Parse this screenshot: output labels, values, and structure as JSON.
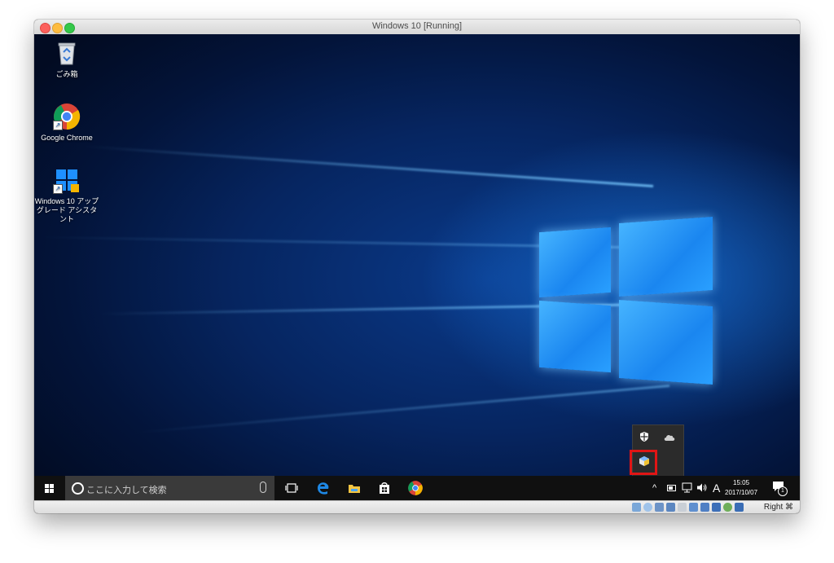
{
  "window": {
    "title": "Windows 10 [Running]"
  },
  "desktop": {
    "icons": [
      {
        "label": "ごみ箱",
        "icon": "recycle-bin-icon"
      },
      {
        "label": "Google Chrome",
        "icon": "chrome-icon"
      },
      {
        "label_line1": "Windows 10 アップ",
        "label_line2": "グレード アシスタント",
        "icon": "windows-upgrade-icon"
      }
    ]
  },
  "taskbar": {
    "search_placeholder": "ここに入力して検索",
    "pinned": [
      "task-view-icon",
      "edge-icon",
      "file-explorer-icon",
      "store-icon",
      "chrome-icon"
    ],
    "tray": {
      "chevron": "^",
      "ime": "A",
      "time": "15:05",
      "date": "2017/10/07",
      "notifications_count": "1"
    }
  },
  "tray_overflow": {
    "icons": [
      "defender-icon",
      "onedrive-icon",
      "virtualbox-icon"
    ]
  },
  "host_statusbar": {
    "host_key": "Right ⌘"
  },
  "colors": {
    "highlight": "#e01515",
    "taskbar": "#101010",
    "search": "#3a3a3a"
  }
}
